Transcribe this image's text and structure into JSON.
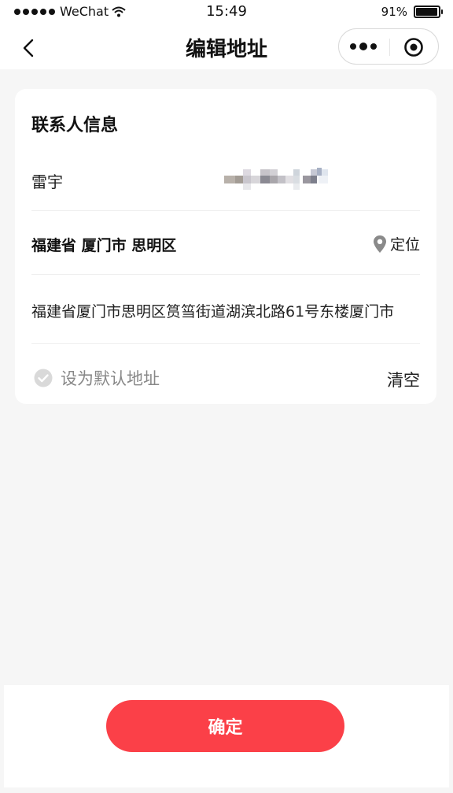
{
  "status_bar": {
    "carrier": "WeChat",
    "time": "15:49",
    "battery": "91%",
    "battery_level": 0.91
  },
  "nav": {
    "title": "编辑地址"
  },
  "contact": {
    "section_title": "联系人信息",
    "name": "雷宇"
  },
  "address": {
    "region": "福建省 厦门市 思明区",
    "locate_label": "定位",
    "detail": "福建省厦门市思明区筼筜街道湖滨北路61号东楼厦门市"
  },
  "options": {
    "default_label": "设为默认地址",
    "clear_label": "清空"
  },
  "footer": {
    "confirm_label": "确定"
  },
  "colors": {
    "accent": "#fb4048",
    "background": "#f6f6f6",
    "card": "#ffffff"
  }
}
